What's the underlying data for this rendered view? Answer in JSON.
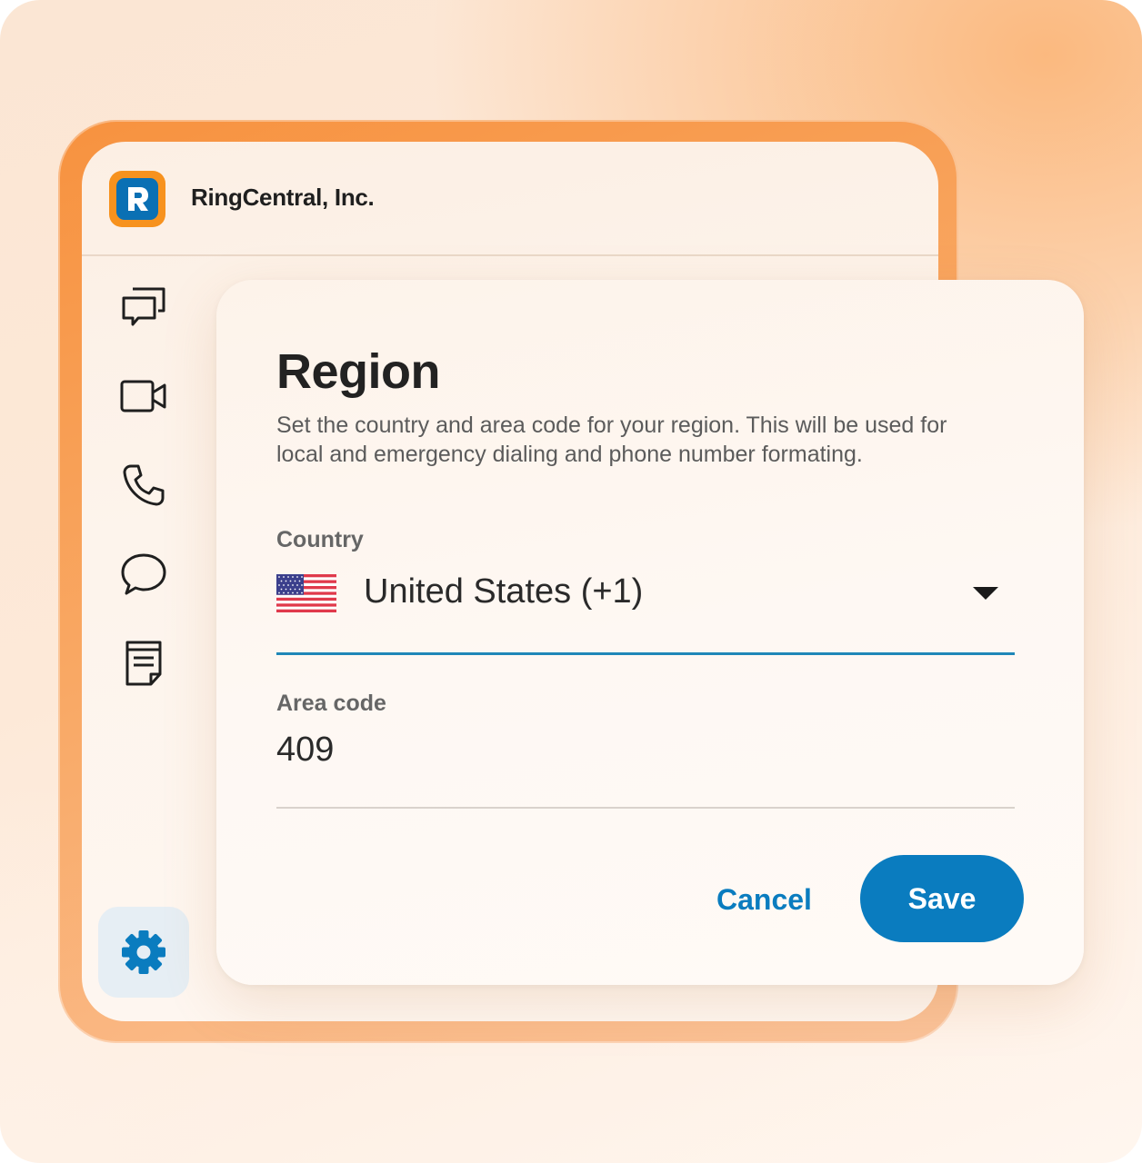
{
  "app": {
    "company_name": "RingCentral, Inc.",
    "logo_icon": "ringcentral-logo-icon",
    "colors": {
      "brand_orange": "#f7921e",
      "brand_blue": "#0a70b4",
      "accent": "#0a7cbf"
    }
  },
  "sidebar": {
    "items": [
      {
        "name": "messages",
        "icon": "chat-bubbles-icon"
      },
      {
        "name": "video",
        "icon": "video-camera-icon"
      },
      {
        "name": "phone",
        "icon": "phone-icon"
      },
      {
        "name": "text",
        "icon": "speech-bubble-icon"
      },
      {
        "name": "notes",
        "icon": "note-icon"
      }
    ],
    "settings_icon": "gear-icon"
  },
  "dialog": {
    "title": "Region",
    "description": "Set the country and area code for your region. This will be used for local and emergency dialing and phone number formating.",
    "country": {
      "label": "Country",
      "value": "United States (+1)",
      "flag_icon": "us-flag-icon"
    },
    "area_code": {
      "label": "Area code",
      "value": "409"
    },
    "cancel_label": "Cancel",
    "save_label": "Save"
  }
}
